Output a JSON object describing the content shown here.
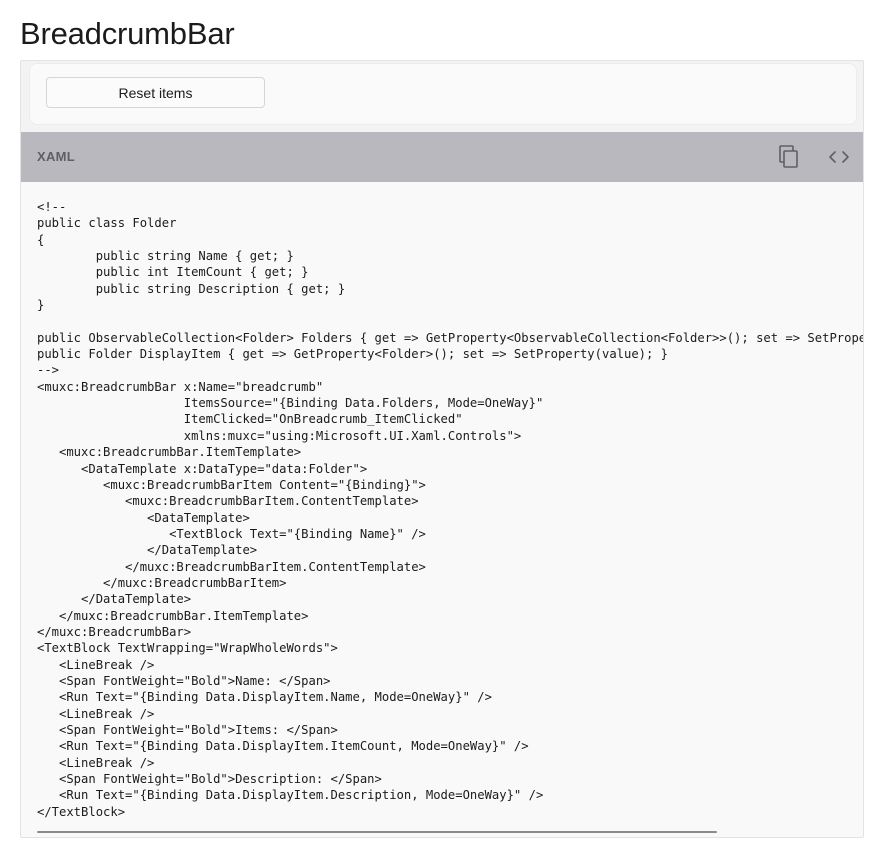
{
  "page": {
    "title": "BreadcrumbBar"
  },
  "example": {
    "reset_button_label": "Reset items"
  },
  "code_viewer": {
    "language_label": "XAML",
    "copy_icon": "copy-icon",
    "toggle_code_icon": "code-brackets-icon",
    "source": "<!--\npublic class Folder\n{\n        public string Name { get; }\n        public int ItemCount { get; }\n        public string Description { get; }\n}\n\npublic ObservableCollection<Folder> Folders { get => GetProperty<ObservableCollection<Folder>>(); set => SetProperty(value); }\npublic Folder DisplayItem { get => GetProperty<Folder>(); set => SetProperty(value); }\n-->\n<muxc:BreadcrumbBar x:Name=\"breadcrumb\"\n                    ItemsSource=\"{Binding Data.Folders, Mode=OneWay}\"\n                    ItemClicked=\"OnBreadcrumb_ItemClicked\"\n                    xmlns:muxc=\"using:Microsoft.UI.Xaml.Controls\">\n   <muxc:BreadcrumbBar.ItemTemplate>\n      <DataTemplate x:DataType=\"data:Folder\">\n         <muxc:BreadcrumbBarItem Content=\"{Binding}\">\n            <muxc:BreadcrumbBarItem.ContentTemplate>\n               <DataTemplate>\n                  <TextBlock Text=\"{Binding Name}\" />\n               </DataTemplate>\n            </muxc:BreadcrumbBarItem.ContentTemplate>\n         </muxc:BreadcrumbBarItem>\n      </DataTemplate>\n   </muxc:BreadcrumbBar.ItemTemplate>\n</muxc:BreadcrumbBar>\n<TextBlock TextWrapping=\"WrapWholeWords\">\n   <LineBreak />\n   <Span FontWeight=\"Bold\">Name: </Span>\n   <Run Text=\"{Binding Data.DisplayItem.Name, Mode=OneWay}\" />\n   <LineBreak />\n   <Span FontWeight=\"Bold\">Items: </Span>\n   <Run Text=\"{Binding Data.DisplayItem.ItemCount, Mode=OneWay}\" />\n   <LineBreak />\n   <Span FontWeight=\"Bold\">Description: </Span>\n   <Run Text=\"{Binding Data.DisplayItem.Description, Mode=OneWay}\" />\n</TextBlock>"
  },
  "colors": {
    "header_background": "#b9b8be",
    "code_background": "#f9f9f9",
    "card_background": "#f3f3f3"
  }
}
